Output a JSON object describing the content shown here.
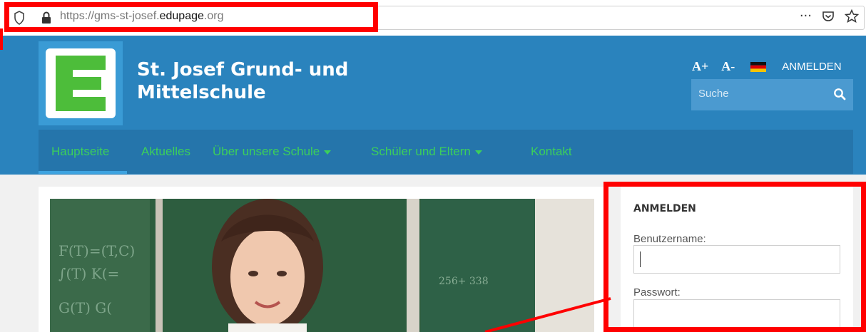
{
  "browser": {
    "url_prefix": "https://gms-st-josef.",
    "url_domain": "edupage",
    "url_suffix": ".org",
    "menu_icon": "···"
  },
  "header": {
    "title_line1": "St. Josef Grund- und",
    "title_line2": "Mittelschule",
    "font_increase": "A+",
    "font_decrease": "A-",
    "login_link": "ANMELDEN",
    "search_placeholder": "Suche"
  },
  "nav": {
    "items": [
      {
        "label": "Hauptseite"
      },
      {
        "label": "Aktuelles"
      },
      {
        "label": "Über unsere Schule"
      },
      {
        "label": "Schüler und Eltern"
      },
      {
        "label": "Kontakt"
      }
    ]
  },
  "login_panel": {
    "title": "ANMELDEN",
    "username_label": "Benutzername:",
    "password_label": "Passwort:"
  },
  "colors": {
    "header_bg": "#2a83bd",
    "nav_bg": "#2575ab",
    "nav_text": "#3ccf5b",
    "highlight": "#ff0000"
  }
}
